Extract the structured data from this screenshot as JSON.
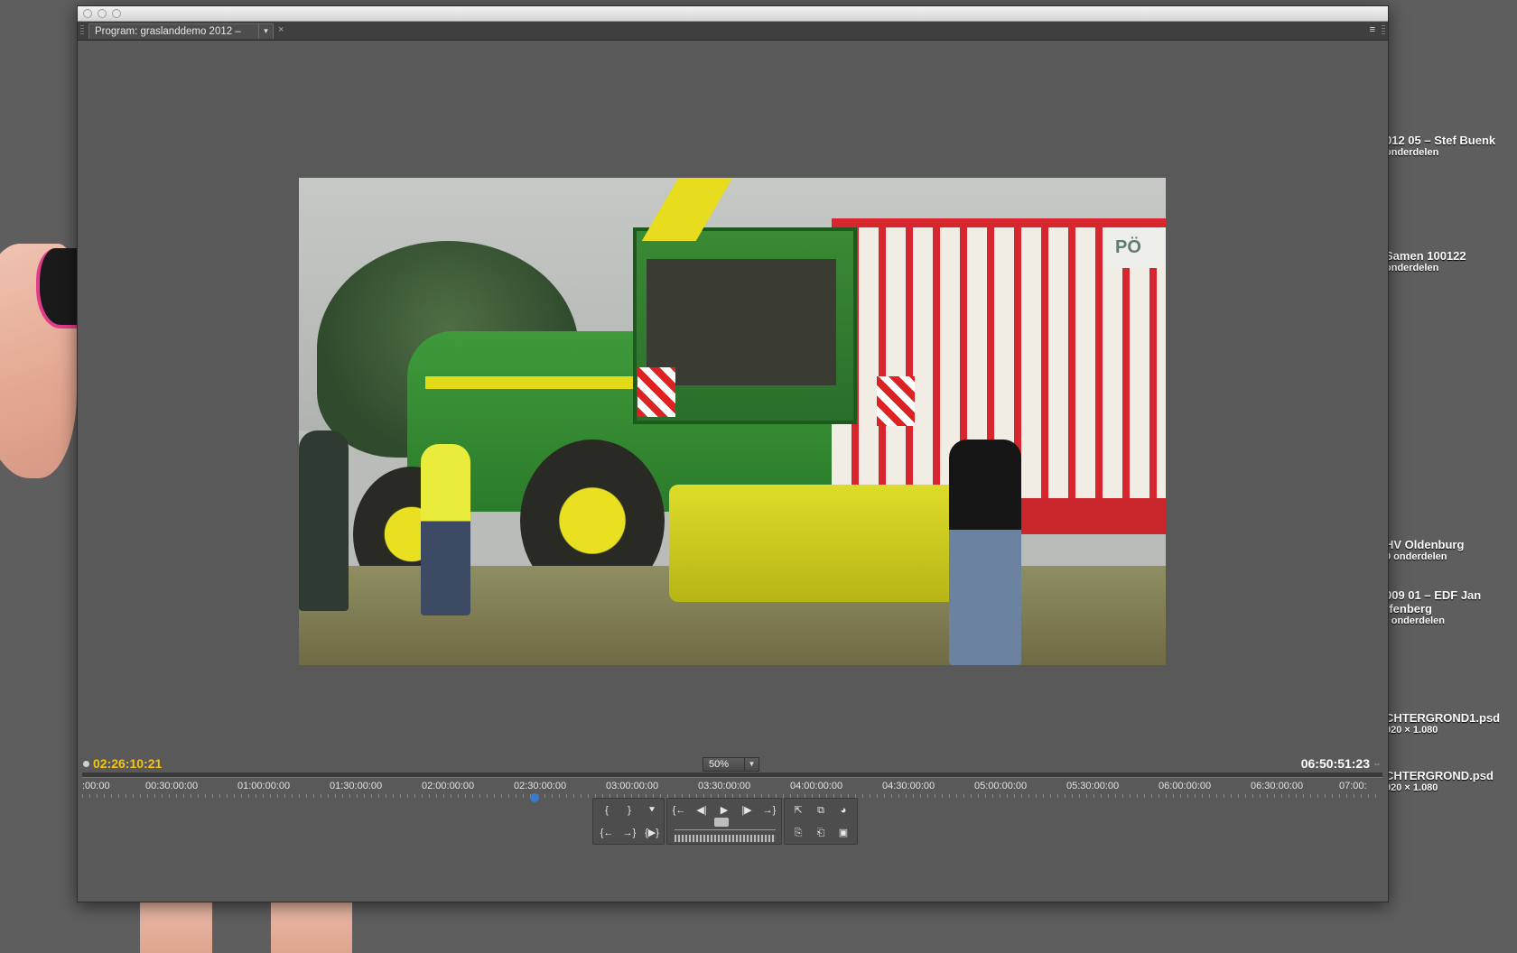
{
  "desktop": {
    "items": [
      {
        "title": "012 05 – Stef Buenk",
        "sub": "onderdelen"
      },
      {
        "title": " Samen 100122",
        "sub": "onderdelen"
      },
      {
        "title": "HV Oldenburg",
        "sub": "0 onderdelen"
      },
      {
        "title": "009 01 – EDF Jan",
        "title2": "ffenberg",
        "sub": ": onderdelen"
      },
      {
        "title": "CHTERGROND1.psd",
        "sub": "920 × 1.080"
      },
      {
        "title": "CHTERGROND.psd",
        "sub": "920 × 1.080"
      }
    ]
  },
  "panel": {
    "tab_label": "Program: graslanddemo 2012 –",
    "dropdown_icon": "▾",
    "close_icon": "×",
    "menu_icon": "≡"
  },
  "monitor": {
    "timecode_current": "02:26:10:21",
    "timecode_duration": "06:50:51:23",
    "zoom_value": "50%",
    "trailer_logo_text": "PÖ",
    "ruler_labels": [
      ":00:00",
      "00:30:00:00",
      "01:00:00:00",
      "01:30:00:00",
      "02:00:00:00",
      "02:30:00:00",
      "03:00:00:00",
      "03:30:00:00",
      "04:00:00:00",
      "04:30:00:00",
      "05:00:00:00",
      "05:30:00:00",
      "06:00:00:00",
      "06:30:00:00",
      "07:00:"
    ]
  },
  "transport": {
    "row1_left": [
      "{",
      "}",
      "⯆"
    ],
    "row1_mid": [
      "{←",
      "◀|",
      "▶",
      "|▶",
      "→}"
    ],
    "row1_right": [
      "⇱",
      "⧉",
      "◕"
    ],
    "row2_left": [
      "{←",
      "→}",
      "{▶}"
    ],
    "row2_right": [
      "⎘",
      "⎗",
      "▣"
    ]
  }
}
